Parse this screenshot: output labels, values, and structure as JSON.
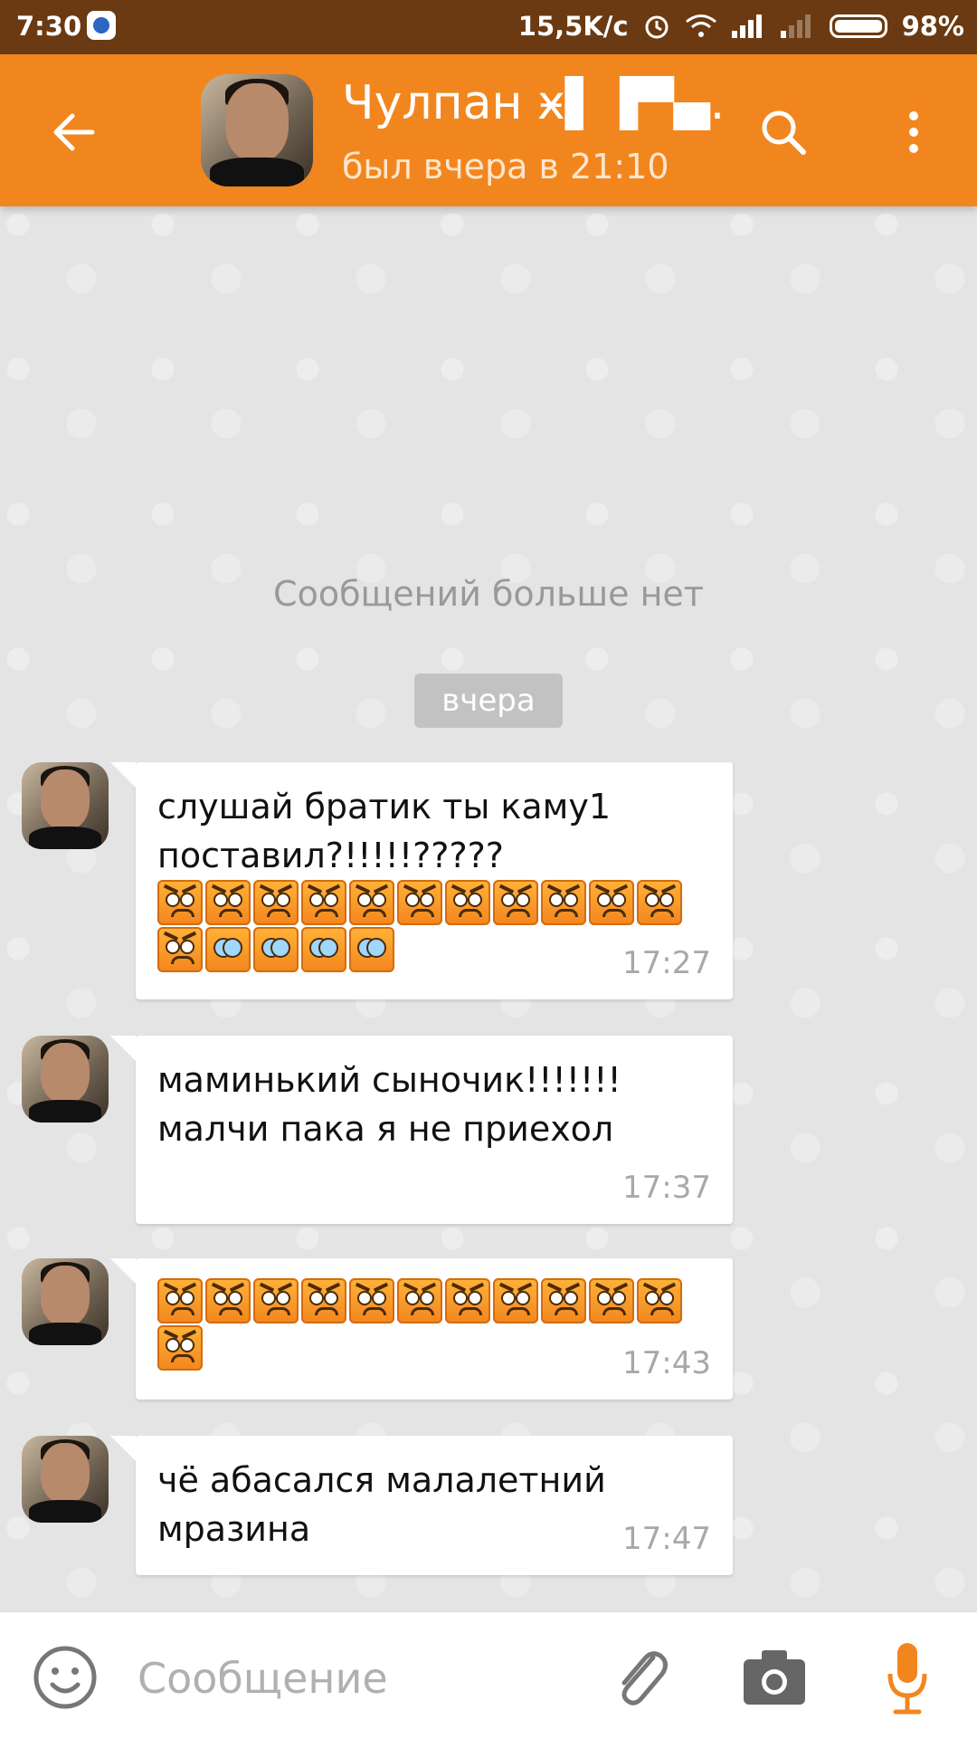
{
  "status_bar": {
    "time": "7:30",
    "net_speed": "15,5K/c",
    "battery": "98%"
  },
  "header": {
    "contact_name": "Чулпан ӿ▌▐▀▄..",
    "last_seen": "был вчера в 21:10"
  },
  "chat": {
    "no_more_text": "Сообщений больше нет",
    "date_label": "вчера",
    "messages": [
      {
        "text": "слушай братик ты каму1 поставил?!!!!!?????",
        "time": "17:27",
        "emoji_rows": [
          [
            "angry",
            "angry",
            "angry",
            "angry",
            "angry",
            "angry",
            "angry",
            "angry",
            "angry",
            "angry",
            "angry"
          ],
          [
            "angry",
            "wide-eyes",
            "wide-eyes",
            "wide-eyes",
            "wide-eyes"
          ]
        ]
      },
      {
        "text": "маминький сыночик!!!!!!!\nмалчи пака я не приехол",
        "time": "17:37",
        "emoji_rows": []
      },
      {
        "text": "",
        "time": "17:43",
        "emoji_rows": [
          [
            "angry",
            "angry",
            "angry",
            "angry",
            "angry",
            "angry",
            "angry",
            "angry",
            "angry",
            "angry",
            "angry"
          ],
          [
            "angry"
          ]
        ]
      },
      {
        "text": "чё абасался малалетний\nмразина",
        "time": "17:47",
        "emoji_rows": []
      }
    ]
  },
  "composer": {
    "placeholder": "Сообщение"
  },
  "colors": {
    "status_bar": "#6b3a12",
    "header": "#f2861e",
    "accent": "#f2861e"
  }
}
